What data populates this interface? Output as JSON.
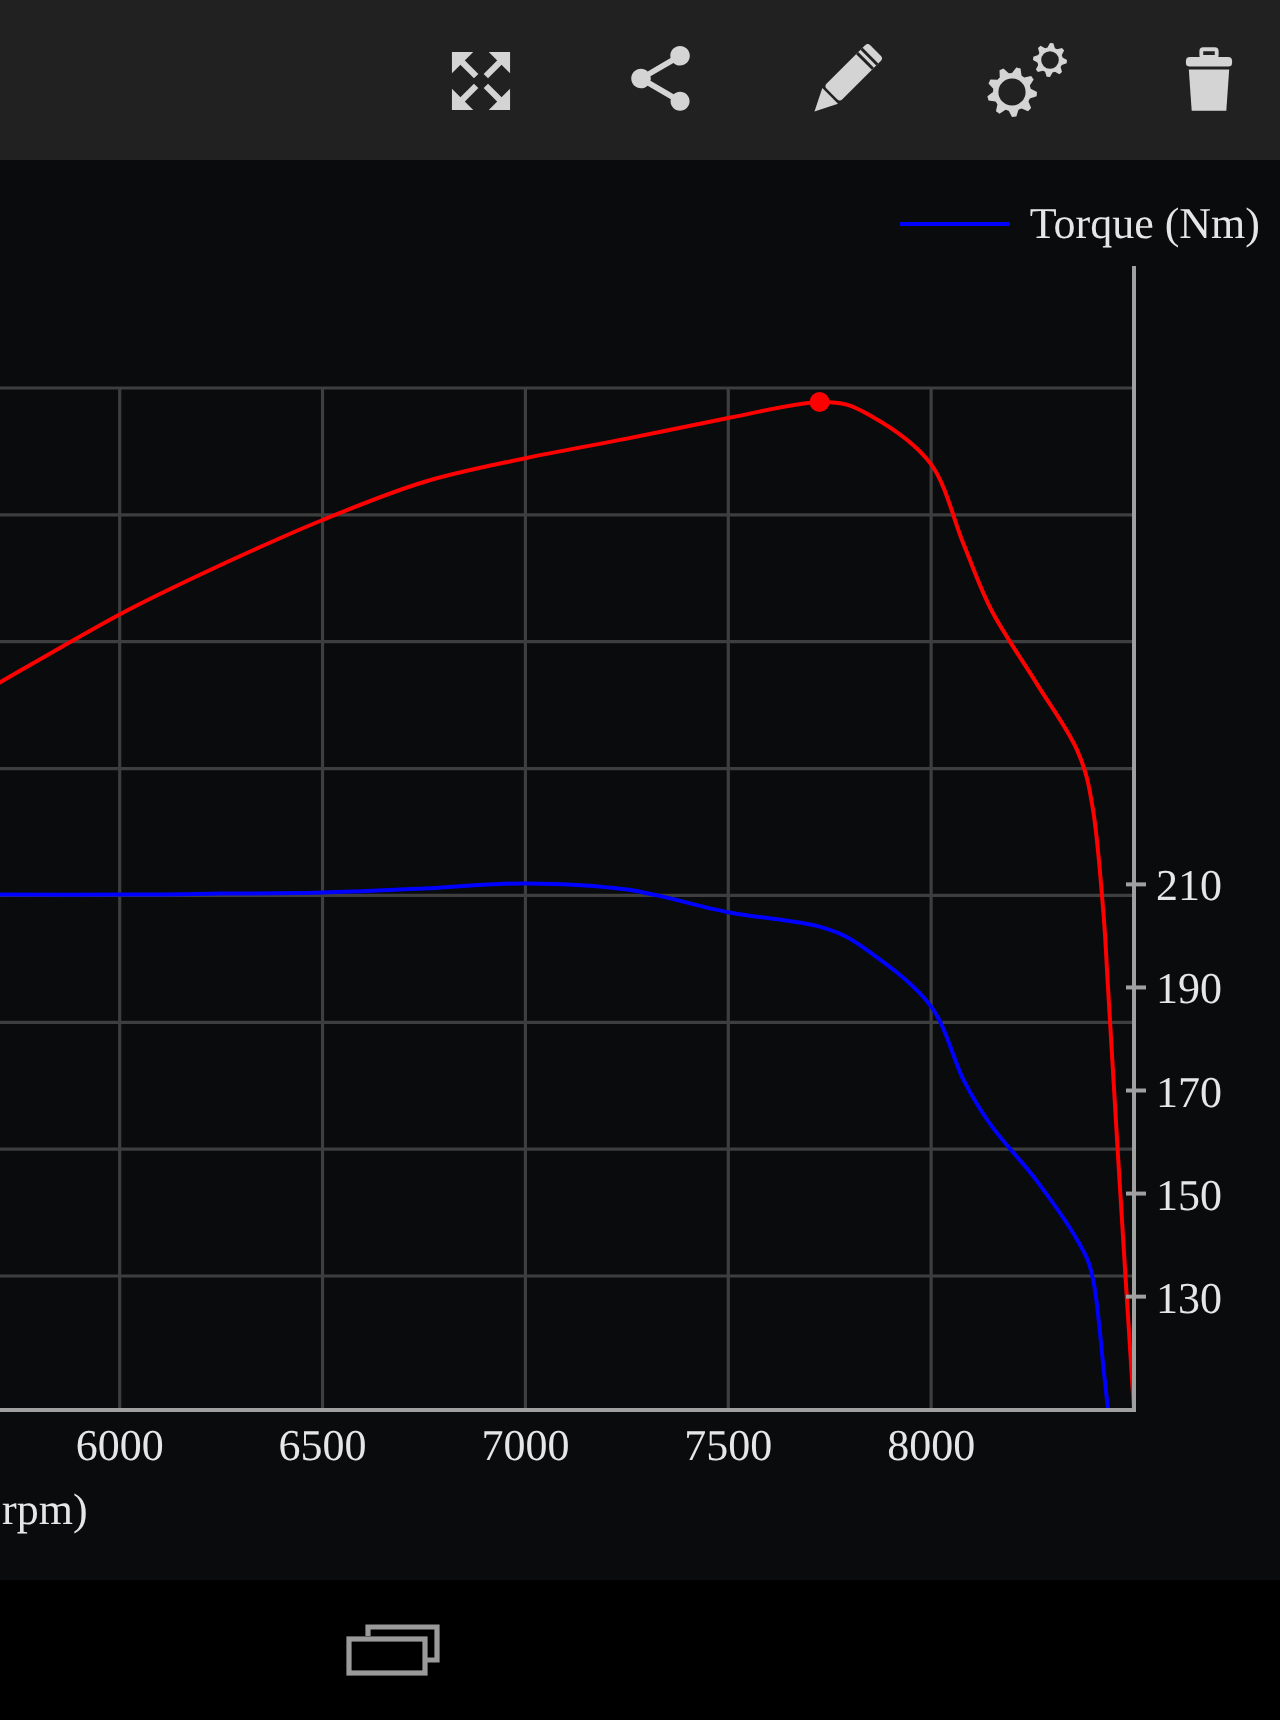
{
  "chart": {
    "chart_data": {
      "type": "line",
      "xlabel": "rpm)",
      "x": [
        5705,
        6000,
        6250,
        6500,
        6750,
        7000,
        7250,
        7500,
        7725,
        7850,
        8000,
        8080,
        8150,
        8260,
        8360,
        8400,
        8425,
        8436,
        8460,
        8500
      ],
      "series": [
        {
          "name": "Torque (Nm)",
          "color": "#0000ff",
          "values": [
            208.0,
            208.0,
            208.2,
            208.4,
            209.2,
            210.2,
            209.0,
            204.6,
            201.8,
            196.8,
            186.3,
            172.0,
            163.0,
            152.5,
            141.0,
            133.0,
            116.0,
            108.0,
            null,
            null
          ]
        },
        {
          "color": "#ff0000",
          "values": [
            249.2,
            262.4,
            272.0,
            280.7,
            288.1,
            292.7,
            296.5,
            300.5,
            303.6,
            301.0,
            291.5,
            276.0,
            263.0,
            249.0,
            236.0,
            224.0,
            204.0,
            190.0,
            158.0,
            108.0
          ]
        }
      ],
      "xlim": [
        5705,
        8500
      ],
      "ylim": [
        108,
        330
      ],
      "xticks": [
        6000,
        6500,
        7000,
        7500,
        8000
      ],
      "yticks": [
        130,
        150,
        170,
        190,
        210
      ],
      "grid": true
    }
  }
}
